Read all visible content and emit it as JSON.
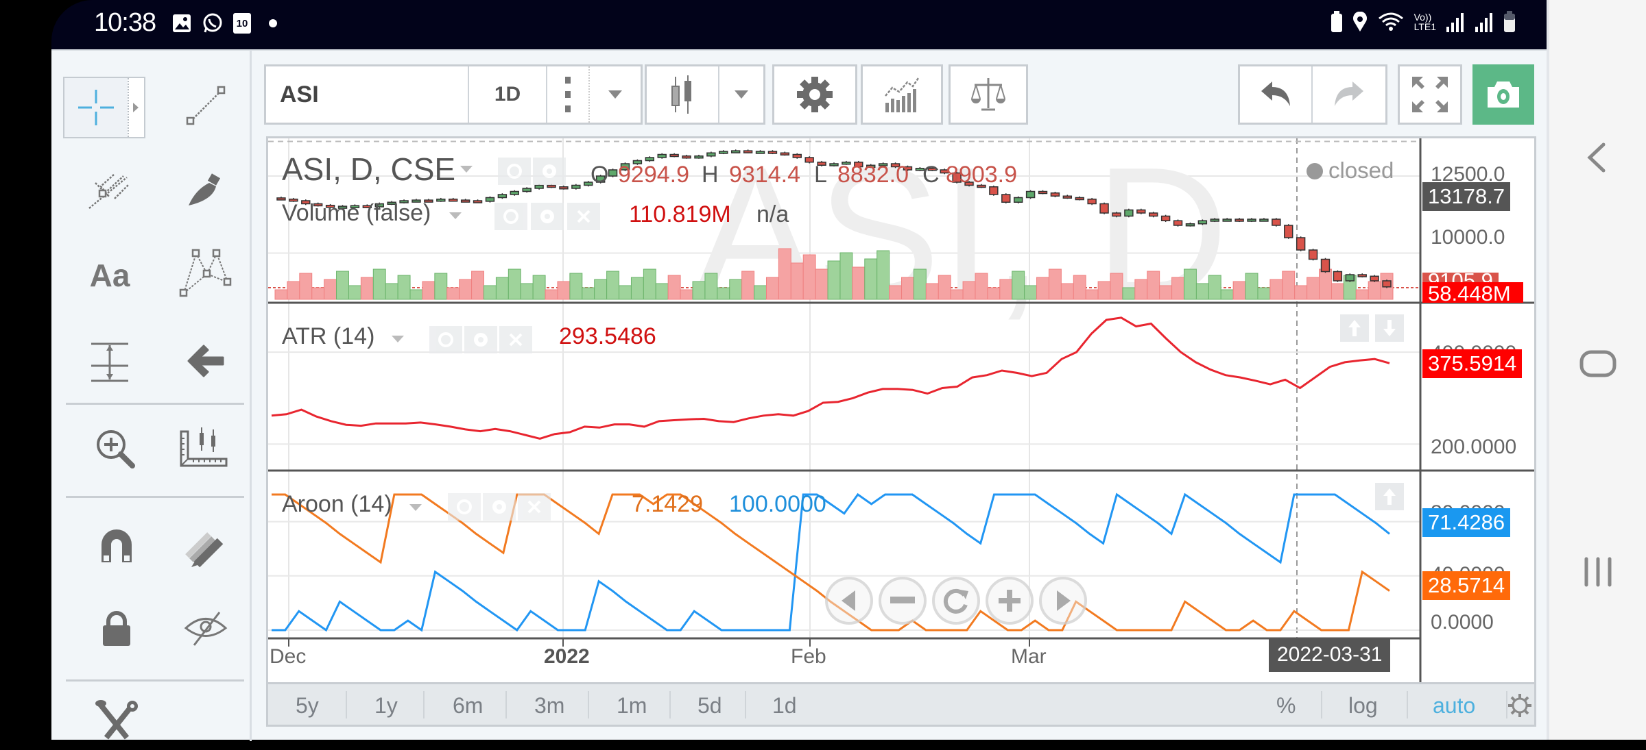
{
  "status_bar": {
    "time": "10:38",
    "left_icons": [
      "gallery-icon",
      "whatsapp-icon",
      "calendar-icon",
      "notification-dot"
    ],
    "calendar_day": "10",
    "right_icons": [
      "battery-saver-icon",
      "location-icon",
      "wifi-icon",
      "volte-icon",
      "signal-icon",
      "signal-icon",
      "battery-icon"
    ],
    "volte_label_top": "Vo))",
    "volte_label_bottom": "LTE1"
  },
  "toolbar": {
    "symbol": "ASI",
    "interval": "1D",
    "buttons": [
      "chart-type",
      "settings",
      "indicators",
      "compare"
    ],
    "undo_label": "undo",
    "redo_label": "redo"
  },
  "left_tools": [
    {
      "name": "crosshair",
      "active": true
    },
    {
      "name": "trend-line"
    },
    {
      "name": "pitchfork"
    },
    {
      "name": "brush"
    },
    {
      "name": "text"
    },
    {
      "name": "pattern"
    },
    {
      "name": "measure"
    },
    {
      "name": "arrow"
    },
    {
      "name": "zoom-in"
    },
    {
      "name": "ruler"
    },
    {
      "name": "magnet"
    },
    {
      "name": "drawing-mode"
    },
    {
      "name": "lock"
    },
    {
      "name": "hide-drawings"
    },
    {
      "name": "tools"
    }
  ],
  "main_panel": {
    "title": "ASI, D, CSE",
    "watermark": "ASI, D",
    "ohlc": {
      "o_label": "O",
      "o": "9294.9",
      "h_label": "H",
      "h": "9314.4",
      "l_label": "L",
      "l": "8832.0",
      "c_label": "C",
      "c": "8903.9"
    },
    "volume_label": "Volume (false)",
    "volume_value": "110.819M",
    "volume_extra": "n/a",
    "market_status": "closed",
    "y_ticks": [
      "12500.0",
      "10000.0"
    ],
    "crosshair_price": "13178.7",
    "last_price_label": "9105.9",
    "last_volume_label": "58.448M"
  },
  "atr_panel": {
    "title": "ATR (14)",
    "value": "293.5486",
    "y_ticks": [
      "400.0000",
      "200.0000"
    ],
    "last_value": "375.5914"
  },
  "aroon_panel": {
    "title": "Aroon (14)",
    "down_value": "7.1429",
    "up_value": "100.0000",
    "y_ticks": [
      "80.0000",
      "40.0000",
      "0.0000"
    ],
    "last_up": "71.4286",
    "last_down": "28.5714"
  },
  "x_axis": {
    "ticks": [
      "Dec",
      "2022",
      "Feb",
      "Mar"
    ],
    "crosshair_date": "2022-03-31"
  },
  "range_buttons": [
    "5y",
    "1y",
    "6m",
    "3m",
    "1m",
    "5d",
    "1d"
  ],
  "scale_buttons": {
    "percent": "%",
    "log": "log",
    "auto": "auto"
  },
  "colors": {
    "up": "#5ea86b",
    "down": "#d9534a",
    "atr": "#e8252f",
    "aroon_up": "#2196f3",
    "aroon_down": "#f27a20",
    "accent": "#4db0de",
    "snapshot": "#5cb887"
  },
  "chart_data": [
    {
      "type": "candlestick",
      "title": "ASI, D, CSE",
      "x_range": [
        "2021-11-30",
        "2022-04-08"
      ],
      "ylim": [
        8500,
        13500
      ],
      "y_ticks": [
        10000,
        12500
      ],
      "close": [
        11750,
        11700,
        11600,
        11550,
        11500,
        11520,
        11540,
        11500,
        11600,
        11650,
        11700,
        11720,
        11700,
        11750,
        11720,
        11700,
        11680,
        11800,
        11900,
        12000,
        12100,
        12200,
        12150,
        12100,
        12200,
        12300,
        12500,
        12700,
        12900,
        13000,
        13100,
        13200,
        13150,
        13100,
        13150,
        13250,
        13300,
        13320,
        13280,
        13300,
        13250,
        13200,
        13100,
        12950,
        12850,
        12900,
        12950,
        12800,
        12850,
        12900,
        12800,
        12700,
        12750,
        12700,
        12600,
        12300,
        12200,
        12150,
        11900,
        11650,
        11800,
        12000,
        11950,
        11850,
        11800,
        11750,
        11600,
        11300,
        11200,
        11400,
        11300,
        11200,
        11050,
        10900,
        10950,
        11050,
        11100,
        11100,
        11050,
        11100,
        11100,
        10900,
        10500,
        10100,
        9800,
        9400,
        9100,
        9300,
        9250,
        9100,
        8904
      ],
      "volume_ylim_M": [
        0,
        500
      ]
    },
    {
      "type": "line",
      "title": "ATR (14)",
      "ylim": [
        150,
        500
      ],
      "y_ticks": [
        200,
        400
      ],
      "series": [
        {
          "name": "ATR",
          "values": [
            262,
            265,
            275,
            260,
            250,
            242,
            240,
            245,
            245,
            245,
            247,
            243,
            238,
            232,
            228,
            233,
            228,
            220,
            212,
            222,
            226,
            238,
            236,
            243,
            243,
            238,
            250,
            252,
            254,
            255,
            250,
            248,
            256,
            262,
            265,
            262,
            272,
            290,
            292,
            300,
            312,
            320,
            320,
            318,
            310,
            322,
            325,
            345,
            350,
            360,
            355,
            348,
            355,
            385,
            400,
            440,
            470,
            475,
            456,
            462,
            430,
            400,
            378,
            362,
            350,
            345,
            338,
            330,
            340,
            322,
            345,
            368,
            378,
            382,
            385,
            376
          ]
        }
      ]
    },
    {
      "type": "line",
      "title": "Aroon (14)",
      "ylim": [
        0,
        100
      ],
      "y_ticks": [
        0,
        40,
        80
      ],
      "series": [
        {
          "name": "Aroon Up",
          "values": [
            0,
            0,
            14,
            7,
            0,
            21,
            14,
            7,
            0,
            0,
            7,
            0,
            43,
            36,
            29,
            21,
            14,
            7,
            0,
            14,
            7,
            0,
            0,
            0,
            36,
            29,
            21,
            14,
            7,
            0,
            0,
            14,
            7,
            0,
            0,
            0,
            0,
            0,
            0,
            100,
            100,
            93,
            86,
            100,
            93,
            100,
            100,
            100,
            93,
            86,
            79,
            71,
            64,
            100,
            100,
            100,
            100,
            93,
            86,
            79,
            71,
            64,
            100,
            93,
            86,
            79,
            71,
            100,
            93,
            86,
            79,
            71,
            64,
            57,
            50,
            100,
            100,
            100,
            100,
            93,
            86,
            79,
            71
          ]
        },
        {
          "name": "Aroon Down",
          "values": [
            100,
            100,
            93,
            86,
            79,
            71,
            64,
            57,
            50,
            100,
            100,
            100,
            93,
            86,
            79,
            71,
            64,
            57,
            100,
            100,
            100,
            93,
            86,
            79,
            71,
            100,
            100,
            100,
            93,
            100,
            100,
            93,
            86,
            79,
            71,
            64,
            57,
            50,
            43,
            36,
            29,
            21,
            14,
            7,
            0,
            0,
            0,
            7,
            0,
            0,
            0,
            0,
            14,
            7,
            0,
            0,
            7,
            0,
            0,
            21,
            14,
            7,
            0,
            0,
            0,
            0,
            0,
            21,
            14,
            7,
            0,
            0,
            7,
            0,
            0,
            14,
            7,
            0,
            0,
            0,
            43,
            36,
            29
          ]
        }
      ]
    }
  ]
}
